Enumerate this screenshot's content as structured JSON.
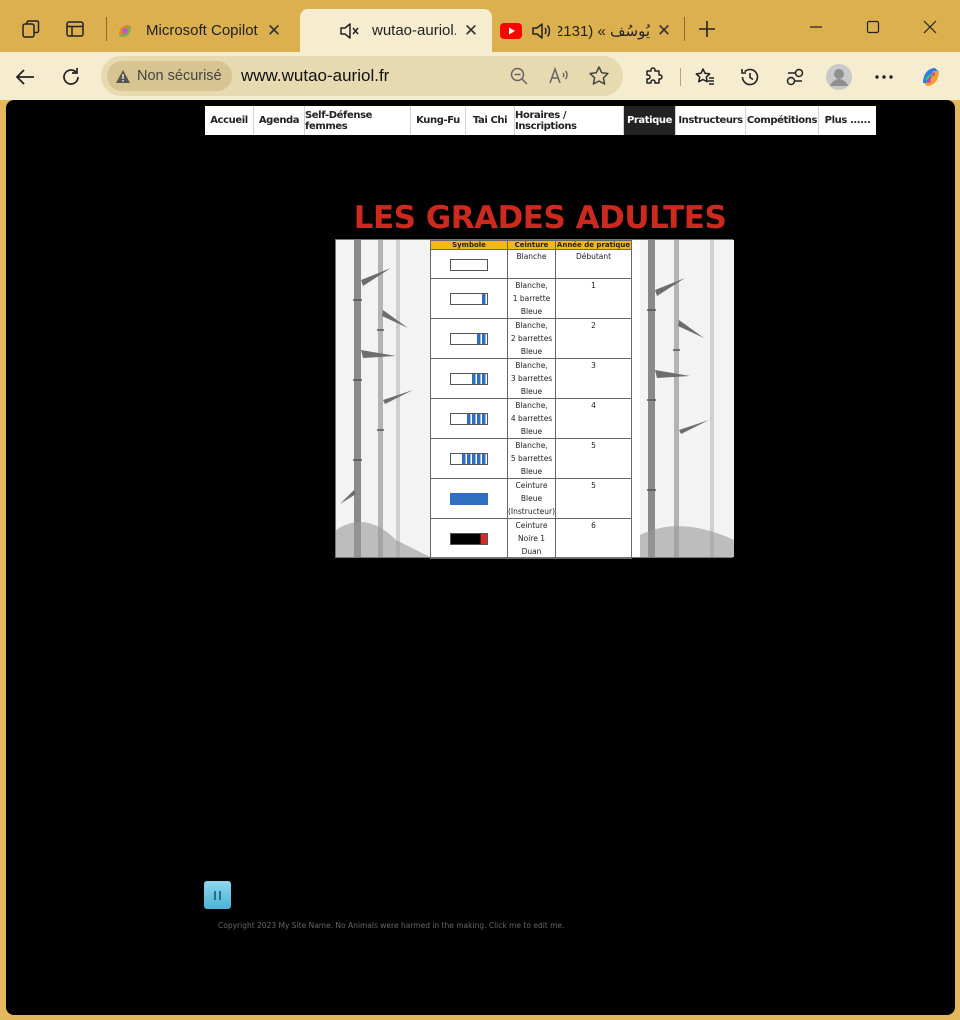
{
  "tabs": [
    {
      "title": "Microsoft Copilot",
      "favicon": "copilot-icon"
    },
    {
      "title": "wutao-auriol.fr",
      "favicon": "muted-speaker-icon",
      "active": true
    },
    {
      "title": "يُوسُف » (2131)",
      "favicon": "youtube-icon",
      "audio": "speaker-icon"
    }
  ],
  "address": {
    "security": "Non sécurisé",
    "url": "www.wutao-auriol.fr"
  },
  "nav": {
    "items": [
      "Accueil",
      "Agenda",
      "Self-Défense femmes",
      "Kung-Fu",
      "Tai Chi",
      "Horaires / Inscriptions",
      "Pratique",
      "Instructeurs",
      "Compétitions",
      "Plus ......"
    ],
    "active": "Pratique"
  },
  "page": {
    "title": "LES GRADES ADULTES",
    "copyright": "Copyright 2023 My Site Name. No Animals were harmed in the making. Click me to edit me."
  },
  "grades": {
    "headers": [
      "Symbole",
      "Ceinture",
      "Année de pratique"
    ],
    "rows": [
      {
        "ceinture": [
          "Blanche"
        ],
        "annee": "Débutant",
        "bars": 0
      },
      {
        "ceinture": [
          "Blanche,",
          "1 barrette",
          "Bleue"
        ],
        "annee": "1",
        "bars": 1
      },
      {
        "ceinture": [
          "Blanche,",
          "2 barrettes",
          "Bleue"
        ],
        "annee": "2",
        "bars": 2
      },
      {
        "ceinture": [
          "Blanche,",
          "3 barrettes",
          "Bleue"
        ],
        "annee": "3",
        "bars": 3
      },
      {
        "ceinture": [
          "Blanche,",
          "4 barrettes",
          "Bleue"
        ],
        "annee": "4",
        "bars": 4
      },
      {
        "ceinture": [
          "Blanche,",
          "5 barrettes",
          "Bleue"
        ],
        "annee": "5",
        "bars": 5
      },
      {
        "ceinture": [
          "Ceinture",
          "Bleue",
          "(Instructeur)"
        ],
        "annee": "5",
        "bars": "blue"
      },
      {
        "ceinture": [
          "Ceinture",
          "Noire 1",
          "Duan"
        ],
        "annee": "6",
        "bars": "black"
      }
    ]
  },
  "colors": {
    "tabstrip": "#dcb04f",
    "toolbar": "#f6ecd0",
    "title_red": "#cc2a1e",
    "belt_blue": "#2e6fbf",
    "header_yellow": "#f5b619"
  }
}
